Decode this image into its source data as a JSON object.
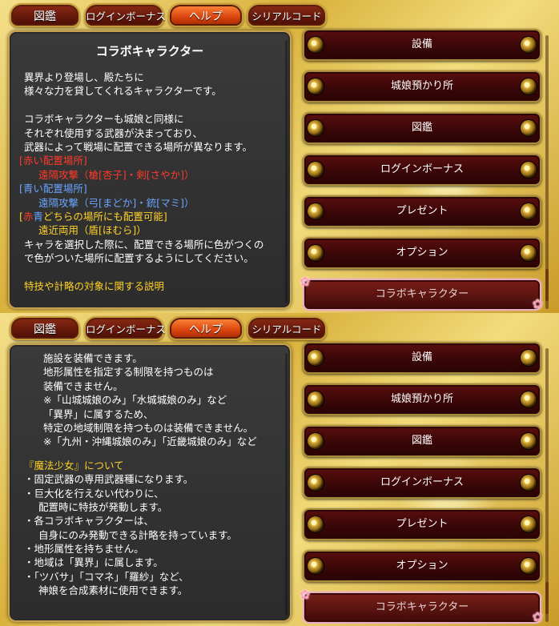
{
  "tabs": [
    "図鑑",
    "ログインボーナス",
    "ヘルプ",
    "シリアルコード"
  ],
  "active_tab": "ヘルプ",
  "menu": [
    "設備",
    "城娘預かり所",
    "図鑑",
    "ログインボーナス",
    "プレゼント",
    "オプション",
    "コラボキャラクター"
  ],
  "selected_menu": "コラボキャラクター",
  "screen1": {
    "title": "コラボキャラクター",
    "lines": {
      "l1": "異界より登場し、殿たちに",
      "l2": "様々な力を貸してくれるキャラクターです。",
      "l3": "コラボキャラクターも城娘と同様に",
      "l4": "それぞれ使用する武器が決まっており、",
      "l5": "武器によって戦場に配置できる場所が異なります。",
      "l6": "[赤い配置場所]",
      "l7": "遠隔攻撃（槍[杏子]・剣[さやか]）",
      "l8": "[青い配置場所]",
      "l9": "遠隔攻撃（弓[まどか]・銃[マミ]）",
      "l10a": "[",
      "l10b": "赤",
      "l10c": "青",
      "l10d": "どちらの場所にも配置可能]",
      "l11": "遠近両用（盾[ほむら]）",
      "l12": "キャラを選択した際に、配置できる場所に色がつくの",
      "l13": "で色がついた場所に配置するようにしてください。",
      "l14": "特技や計略の対象に関する説明"
    }
  },
  "screen2": {
    "lines": {
      "m1": "施設を装備できます。",
      "m2": "地形属性を指定する制限を持つものは",
      "m3": "装備できません。",
      "m4": "※「山城城娘のみ」「水城城娘のみ」など",
      "m5": "「異界」に属するため、",
      "m6": "特定の地域制限を持つものは装備できません。",
      "m7": "※「九州・沖縄城娘のみ」「近畿城娘のみ」など",
      "m8": "『魔法少女』について",
      "m9": "・固定武器の専用武器種になります。",
      "m10": "・巨大化を行えない代わりに、",
      "m11": "配置時に特技が発動します。",
      "m12": "・各コラボキャラクターは、",
      "m13": "自身にのみ発動できる計略を持っています。",
      "m14": "・地形属性を持ちません。",
      "m15": "・地域は「異界」に属します。",
      "m16": "・「ツバサ」「コマネ」「羅紗」など、",
      "m17": "神娘を合成素材に使用できます。"
    }
  },
  "colors": {
    "red_label": "#ff3a2a",
    "blue_label": "#6aa4ff",
    "yellow_label": "#ffd22a",
    "panel_bg": "#333333",
    "menu_bg": "#3a0606",
    "active_tab": "#e0520f"
  }
}
